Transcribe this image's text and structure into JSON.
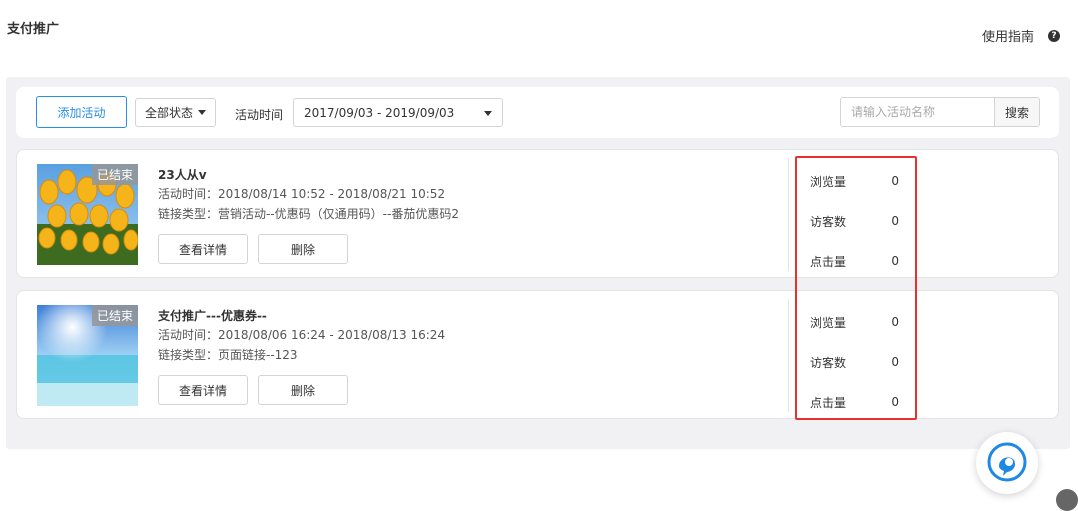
{
  "header": {
    "title": "支付推广",
    "guide_label": "使用指南",
    "guide_icon": "question-circle-icon"
  },
  "toolbar": {
    "add_label": "添加活动",
    "status_label": "全部状态",
    "time_label": "活动时间",
    "date_range": "2017/09/03 - 2019/09/03",
    "search_placeholder": "请输入活动名称",
    "search_label": "搜索"
  },
  "campaigns": [
    {
      "status_tag": "已结束",
      "name": "23人从v",
      "time": "活动时间：2018/08/14 10:52 - 2018/08/21 10:52",
      "link_type": "链接类型：营销活动--优惠码（仅通用码）--番茄优惠码2",
      "detail_label": "查看详情",
      "delete_label": "删除",
      "stats": [
        {
          "label": "浏览量",
          "value": "0"
        },
        {
          "label": "访客数",
          "value": "0"
        },
        {
          "label": "点击量",
          "value": "0"
        }
      ]
    },
    {
      "status_tag": "已结束",
      "name": "支付推广---优惠券--",
      "time": "活动时间：2018/08/06 16:24 - 2018/08/13 16:24",
      "link_type": "链接类型：页面链接--123",
      "detail_label": "查看详情",
      "delete_label": "删除",
      "stats": [
        {
          "label": "浏览量",
          "value": "0"
        },
        {
          "label": "访客数",
          "value": "0"
        },
        {
          "label": "点击量",
          "value": "0"
        }
      ]
    }
  ],
  "colors": {
    "accent": "#2a8ee6",
    "highlight_border": "#e5322d",
    "panel_bg": "#f1f1f3"
  }
}
